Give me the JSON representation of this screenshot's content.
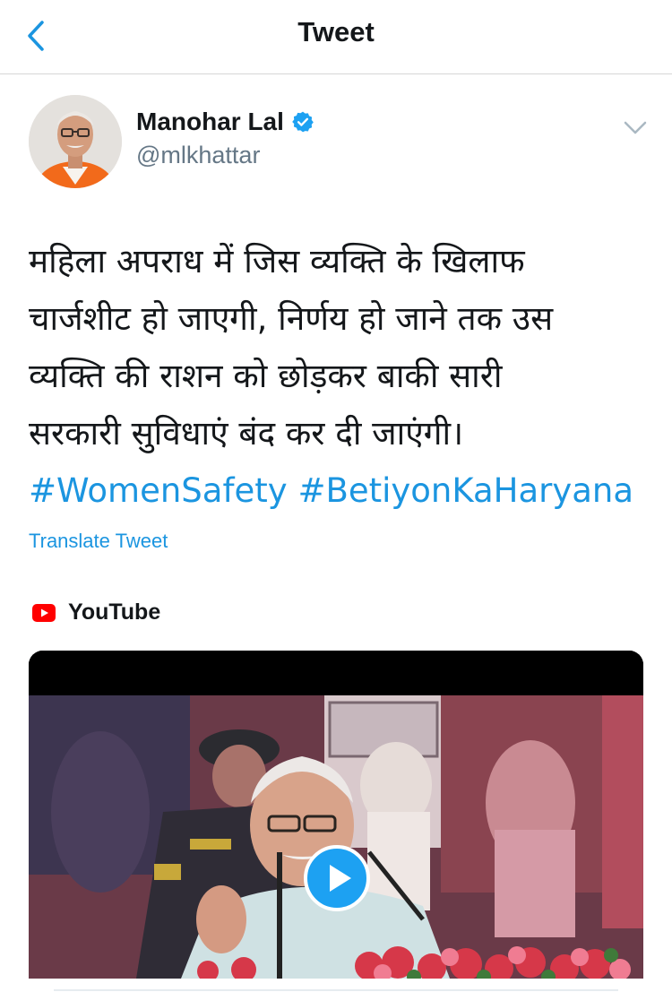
{
  "header": {
    "title": "Tweet",
    "back_icon": "chevron-left-icon"
  },
  "author": {
    "name": "Manohar Lal",
    "handle": "@mlkhattar",
    "verified": true,
    "verified_icon": "verified-badge-icon"
  },
  "tweet": {
    "lines": [
      "महिला अपराध में जिस व्यक्ति के खिलाफ",
      "चार्जशीट हो जाएगी, निर्णय हो जाने तक उस",
      "व्यक्ति की राशन को छोड़कर बाकी सारी",
      "सरकारी सुविधाएं बंद कर दी जाएंगी।"
    ],
    "hashtags": [
      "#WomenSafety",
      "#BetiyonKaHaryana"
    ],
    "translate_label": "Translate Tweet"
  },
  "media": {
    "source": "YouTube",
    "source_icon": "youtube-icon",
    "play_icon": "play-icon"
  },
  "colors": {
    "link": "#1b95e0",
    "text": "#14171a",
    "secondary": "#657786",
    "youtube_red": "#ff0000"
  }
}
